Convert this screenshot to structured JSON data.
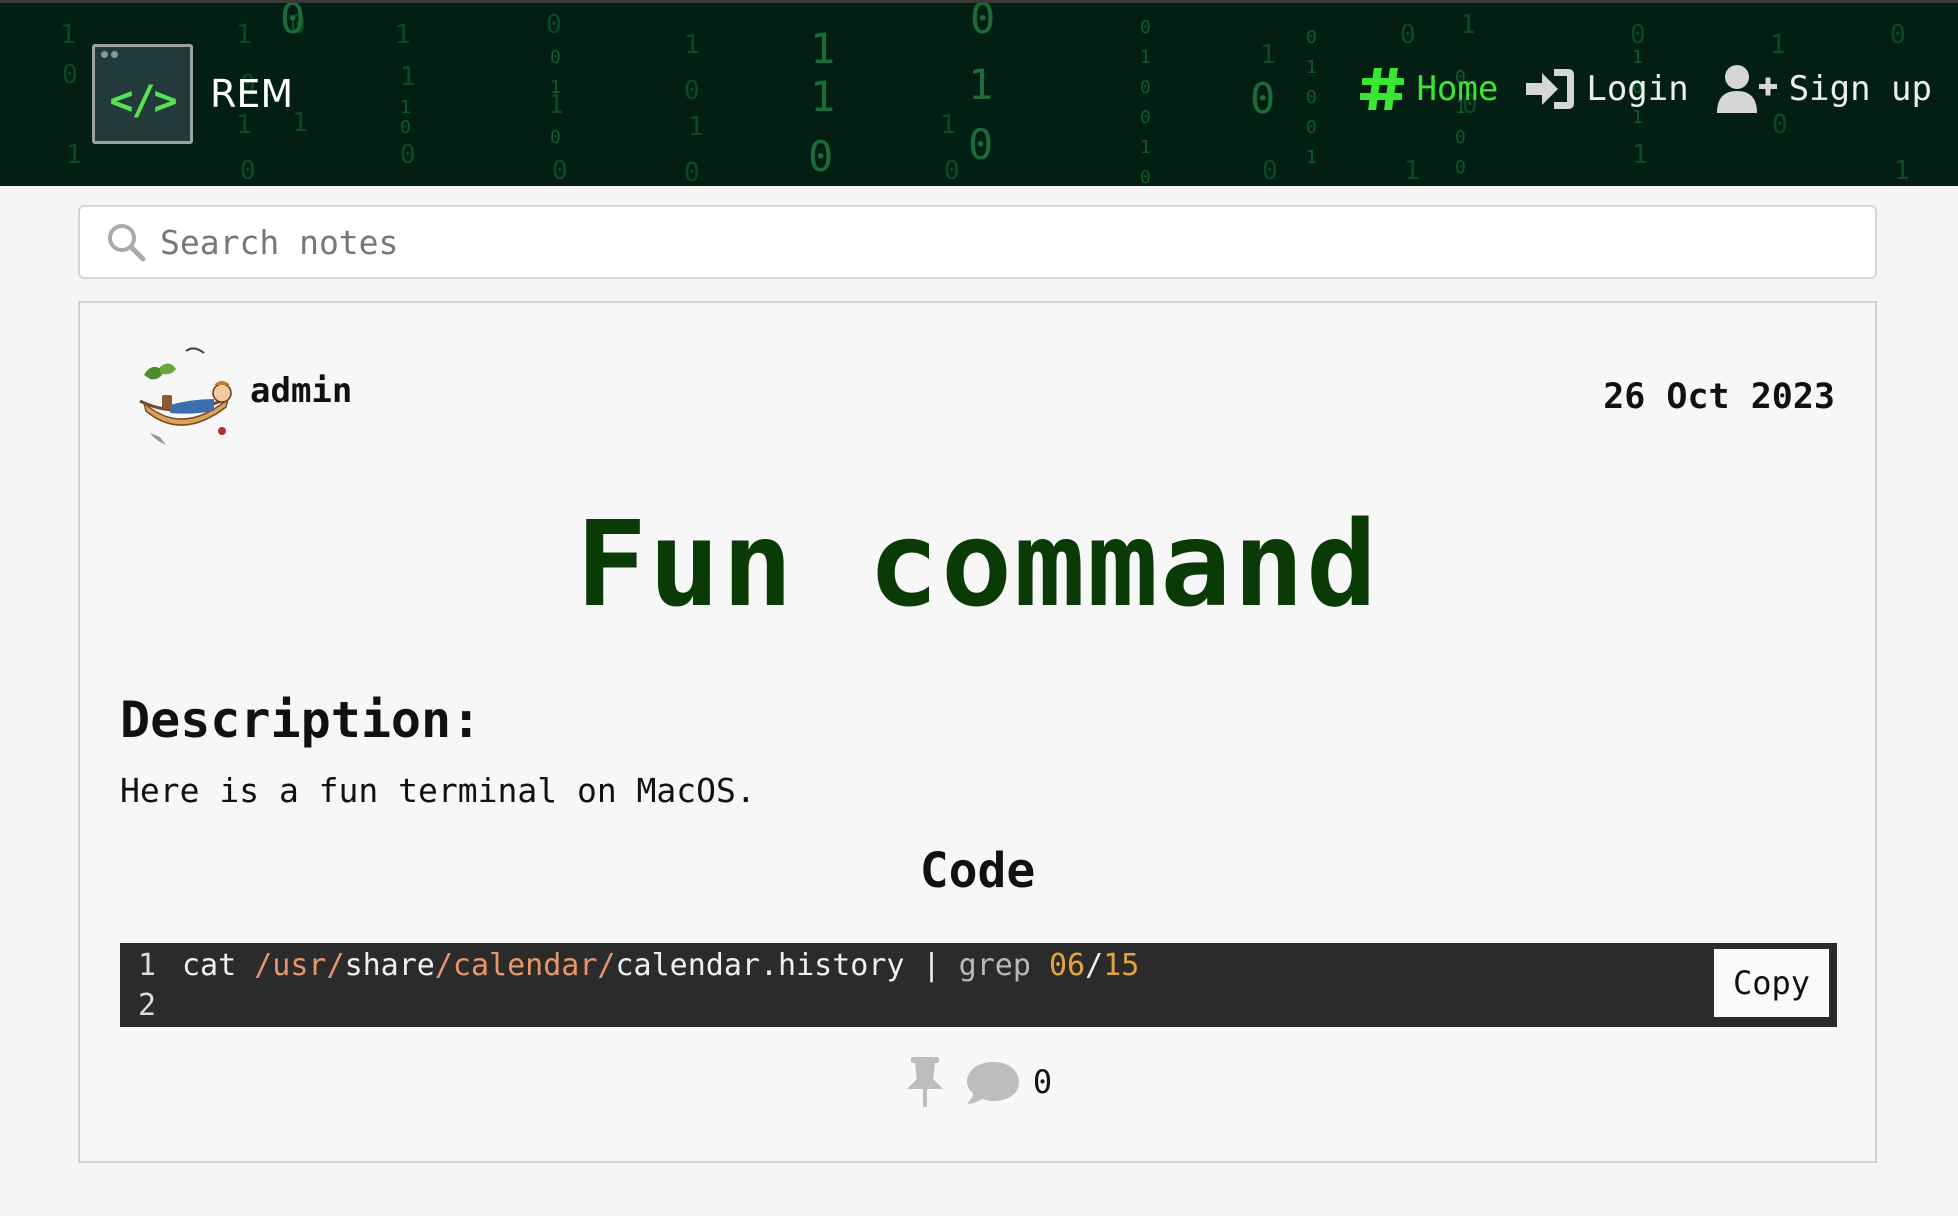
{
  "colors": {
    "header_bg": "#031f13",
    "accent_green": "#39e632",
    "title_green": "#0a3a06",
    "code_bg": "#2b2b2b"
  },
  "header": {
    "brand": {
      "logo_text": "</>",
      "name": "REM"
    },
    "nav": [
      {
        "label": "Home",
        "icon": "hashtag-icon",
        "active": true
      },
      {
        "label": "Login",
        "icon": "login-icon",
        "active": false
      },
      {
        "label": "Sign up",
        "icon": "user-plus-icon",
        "active": false
      }
    ]
  },
  "search": {
    "placeholder": "Search notes",
    "value": ""
  },
  "note": {
    "author": "admin",
    "date": "26 Oct 2023",
    "title": "Fun command",
    "description_heading": "Description:",
    "description": "Here is a fun terminal on MacOS.",
    "code_heading": "Code",
    "code": {
      "lines": [
        {
          "number": "1",
          "tokens": [
            {
              "text": "cat ",
              "kind": "plain"
            },
            {
              "text": "/usr/",
              "kind": "path"
            },
            {
              "text": "share",
              "kind": "plain"
            },
            {
              "text": "/calendar/",
              "kind": "path"
            },
            {
              "text": "calendar.history | ",
              "kind": "plain"
            },
            {
              "text": "grep ",
              "kind": "grep"
            },
            {
              "text": "06",
              "kind": "num"
            },
            {
              "text": "/",
              "kind": "plain"
            },
            {
              "text": "15",
              "kind": "num"
            }
          ]
        },
        {
          "number": "2",
          "tokens": []
        }
      ],
      "copy_label": "Copy"
    },
    "comment_count": "0"
  }
}
